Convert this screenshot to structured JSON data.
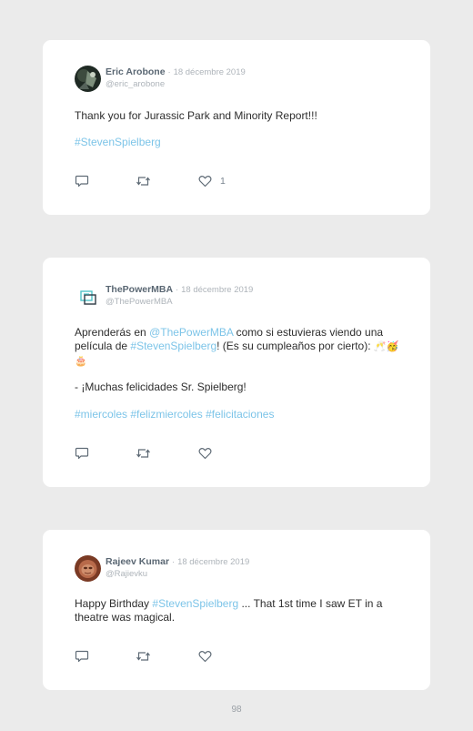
{
  "tweets": [
    {
      "author": "Eric Arobone",
      "separator": "·",
      "date": "18 décembre 2019",
      "handle": "@eric_arobone",
      "body": {
        "line1": "Thank you for Jurassic Park and Minority Report!!!",
        "hashtag": "#StevenSpielberg"
      },
      "likes": "1"
    },
    {
      "author": "ThePowerMBA",
      "separator": "·",
      "date": "18 décembre 2019",
      "handle": "@ThePowerMBA",
      "body": {
        "p1_a": "Aprenderás en ",
        "p1_mention": "@ThePowerMBA",
        "p1_b": " como si estuvieras viendo una película de ",
        "p1_hashtag": "#StevenSpielberg",
        "p1_c": "! (Es su cumpleaños por cierto): ",
        "p1_emoji": "🥂🥳🎂",
        "p2": "- ¡Muchas felicidades Sr. Spielberg!",
        "hashtag1": "#miercoles",
        "hashtag2": "#felizmiercoles",
        "hashtag3": "#felicitaciones"
      },
      "likes": ""
    },
    {
      "author": "Rajeev Kumar",
      "separator": "·",
      "date": "18 décembre 2019",
      "handle": "@Rajievku",
      "body": {
        "a": "Happy Birthday ",
        "hashtag": "#StevenSpielberg",
        "b": " ... That 1st time I saw ET in a theatre was magical."
      },
      "likes": ""
    }
  ],
  "icons": {
    "reply": "reply-icon",
    "retweet": "retweet-icon",
    "like": "heart-icon"
  },
  "colors": {
    "background": "#ebebeb",
    "card": "#ffffff",
    "link": "#7cc4e8",
    "muted": "#aeb4ba",
    "author": "#5a6773"
  },
  "page_number": "98"
}
